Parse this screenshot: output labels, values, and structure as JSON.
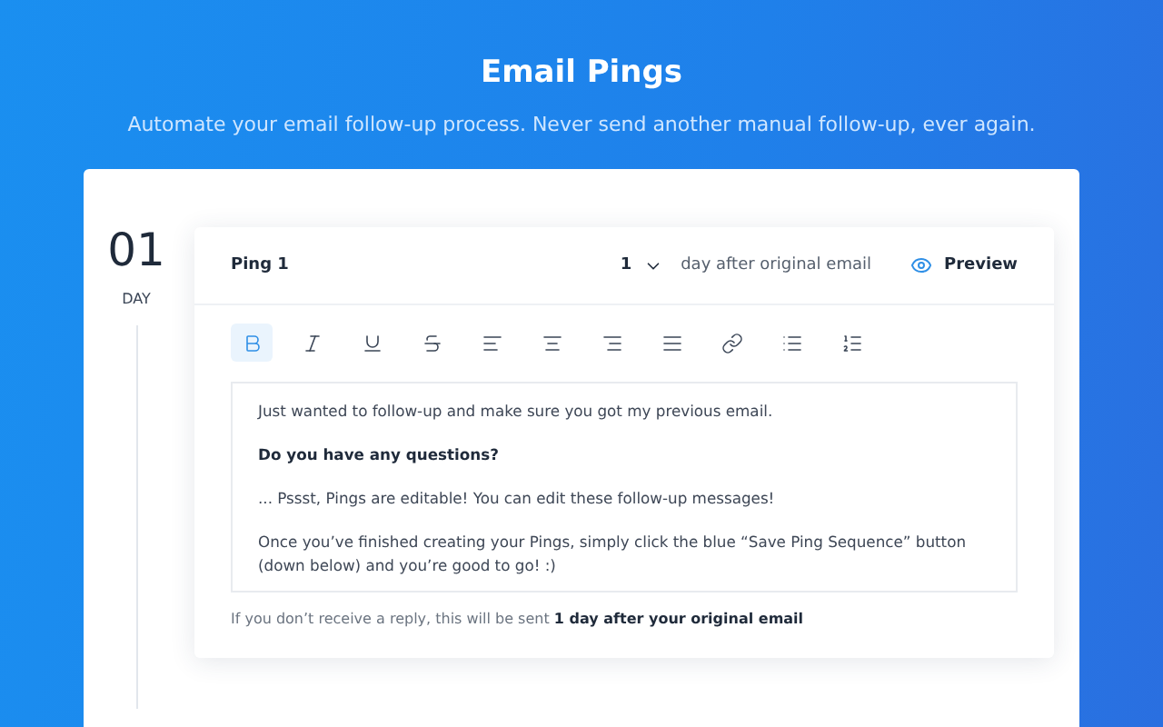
{
  "header": {
    "title": "Email Pings",
    "subtitle": "Automate your email follow-up process. Never send another manual follow-up, ever again."
  },
  "day": {
    "number": "01",
    "label": "DAY"
  },
  "ping": {
    "title": "Ping 1",
    "delay_value": "1",
    "delay_label": "day after original email",
    "preview": "Preview",
    "toolbar": [
      {
        "kind": "bold",
        "selected": true
      },
      {
        "kind": "italic",
        "selected": false
      },
      {
        "kind": "underline",
        "selected": false
      },
      {
        "kind": "strike",
        "selected": false
      },
      {
        "kind": "align-left",
        "selected": false
      },
      {
        "kind": "align-center",
        "selected": false
      },
      {
        "kind": "align-right",
        "selected": false
      },
      {
        "kind": "justify",
        "selected": false
      },
      {
        "kind": "link",
        "selected": false
      },
      {
        "kind": "bullets",
        "selected": false
      },
      {
        "kind": "numbered",
        "selected": false
      }
    ],
    "body": [
      {
        "kind": "plain",
        "text": "Just wanted to follow-up and make sure you got my previous email."
      },
      {
        "kind": "bold",
        "text": "Do you have any questions?"
      },
      {
        "kind": "plain",
        "text": "... Pssst, Pings are editable! You can edit these follow-up messages!"
      },
      {
        "kind": "plain",
        "text": "Once you’ve finished creating your Pings, simply click the blue “Save Ping Sequence” button (down below) and you’re good to go! :)"
      }
    ],
    "footer": "If you don’t receive a reply, this will be sent **1 day after your original email**"
  }
}
